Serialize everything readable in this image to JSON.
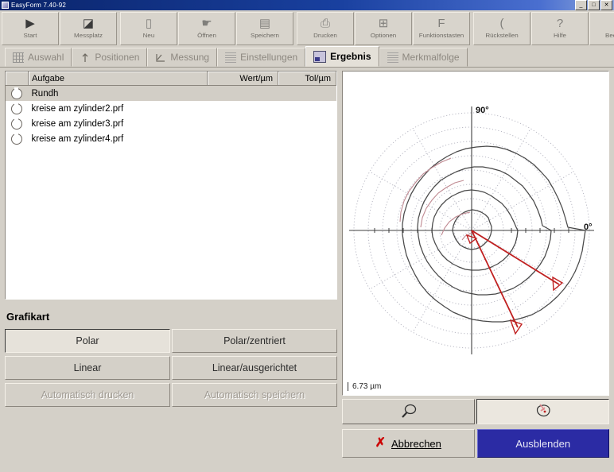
{
  "window": {
    "title": "EasyForm 7.40-92",
    "controls": {
      "minimize": "_",
      "maximize": "□",
      "close": "✕"
    }
  },
  "toolbar": {
    "groups": [
      {
        "buttons": [
          {
            "label": "Start",
            "icon": "play-icon",
            "glyph": "▶",
            "enabled": true
          },
          {
            "label": "Messplatz",
            "icon": "measuring-station-icon",
            "glyph": "◪",
            "enabled": true
          }
        ]
      },
      {
        "buttons": [
          {
            "label": "Neu",
            "icon": "new-document-icon",
            "glyph": "▯",
            "enabled": false
          },
          {
            "label": "Öffnen",
            "icon": "open-folder-icon",
            "glyph": "☛",
            "enabled": false
          },
          {
            "label": "Speichern",
            "icon": "save-disk-icon",
            "glyph": "▤",
            "enabled": false
          }
        ]
      },
      {
        "buttons": [
          {
            "label": "Drucken",
            "icon": "printer-icon",
            "glyph": "⎙",
            "enabled": false
          },
          {
            "label": "Optionen",
            "icon": "options-icon",
            "glyph": "⊞",
            "enabled": false
          },
          {
            "label": "Funktionstasten",
            "icon": "function-key-icon",
            "glyph": "F",
            "enabled": false
          }
        ]
      },
      {
        "buttons": [
          {
            "label": "Rückstellen",
            "icon": "reset-icon",
            "glyph": "(",
            "enabled": false
          },
          {
            "label": "Hilfe",
            "icon": "help-question-icon",
            "glyph": "?",
            "enabled": false
          },
          {
            "label": "Beenden",
            "icon": "exit-close-icon",
            "glyph": "✕",
            "enabled": false
          }
        ]
      }
    ]
  },
  "tabs": [
    {
      "label": "Auswahl",
      "icon": "grid-selection-icon",
      "active": false
    },
    {
      "label": "Positionen",
      "icon": "position-probe-icon",
      "active": false
    },
    {
      "label": "Messung",
      "icon": "measurement-icon",
      "active": false
    },
    {
      "label": "Einstellungen",
      "icon": "settings-icon",
      "active": false
    },
    {
      "label": "Ergebnis",
      "icon": "result-image-icon",
      "active": true
    },
    {
      "label": "Merkmalfolge",
      "icon": "feature-list-icon",
      "active": false
    }
  ],
  "results_table": {
    "columns": [
      "",
      "Aufgabe",
      "Wert/µm",
      "Tol/µm"
    ],
    "rows": [
      {
        "mark": "roundness-symbol",
        "task": "Rundh",
        "wert": "",
        "tol": "",
        "selected": true
      },
      {
        "mark": "roundness-symbol",
        "task": "kreise am zylinder2.prf",
        "wert": "",
        "tol": "",
        "selected": false
      },
      {
        "mark": "roundness-symbol",
        "task": "kreise am zylinder3.prf",
        "wert": "",
        "tol": "",
        "selected": false
      },
      {
        "mark": "roundness-symbol",
        "task": "kreise am zylinder4.prf",
        "wert": "",
        "tol": "",
        "selected": false
      }
    ]
  },
  "grafikart": {
    "title": "Grafikart",
    "buttons": [
      {
        "label": "Polar",
        "state": "pressed"
      },
      {
        "label": "Polar/zentriert",
        "state": "normal"
      },
      {
        "label": "Linear",
        "state": "normal"
      },
      {
        "label": "Linear/ausgerichtet",
        "state": "normal"
      },
      {
        "label": "Automatisch drucken",
        "state": "disabled"
      },
      {
        "label": "Automatisch speichern",
        "state": "disabled"
      }
    ]
  },
  "graph": {
    "label_top": "90°",
    "label_right": "0°",
    "scale": "6.73 µm",
    "trace_color": "#3a3a3a",
    "secondary_trace_color": "#c08a92",
    "marker_color": "#c02020",
    "grid_color": "#b9b9c4"
  },
  "graph_tools": [
    {
      "icon": "magnifier-zoom-icon",
      "state": "normal"
    },
    {
      "icon": "profile-shape-icon",
      "state": "pressed"
    }
  ],
  "actions": [
    {
      "label": "Abbrechen",
      "icon": "red-x-icon",
      "style": "normal"
    },
    {
      "label": "Ausblenden",
      "icon": "",
      "style": "primary"
    }
  ],
  "colors": {
    "face": "#d4d0c8",
    "primary_button": "#2b2ba4",
    "accent_red": "#cc0000",
    "desktop": "#7ba7c4"
  }
}
